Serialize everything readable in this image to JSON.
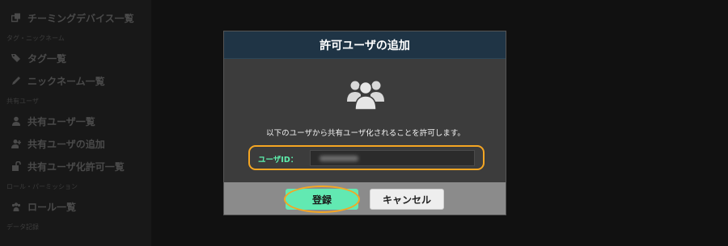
{
  "sidebar": {
    "items": [
      {
        "type": "item",
        "icon": "clone-icon",
        "label": "チーミングデバイス一覧"
      },
      {
        "type": "section",
        "label": "タグ・ニックネーム"
      },
      {
        "type": "item",
        "icon": "tags-icon",
        "label": "タグ一覧"
      },
      {
        "type": "item",
        "icon": "pencil-icon",
        "label": "ニックネーム一覧"
      },
      {
        "type": "section",
        "label": "共有ユーザ"
      },
      {
        "type": "item",
        "icon": "user-icon",
        "label": "共有ユーザ一覧"
      },
      {
        "type": "item",
        "icon": "user-plus-icon",
        "label": "共有ユーザの追加"
      },
      {
        "type": "item",
        "icon": "unlock-icon",
        "label": "共有ユーザ化許可一覧"
      },
      {
        "type": "section",
        "label": "ロール・パーミッション"
      },
      {
        "type": "item",
        "icon": "users-icon",
        "label": "ロール一覧"
      },
      {
        "type": "section",
        "label": "データ記録"
      }
    ]
  },
  "modal": {
    "title": "許可ユーザの追加",
    "icon": "users-icon",
    "message": "以下のユーザから共有ユーザ化されることを許可します。",
    "user_id_label": "ユーザID：",
    "user_id_value": "",
    "save_label": "登録",
    "cancel_label": "キャンセル"
  },
  "colors": {
    "header_bg": "#1f3445",
    "save_button": "#62e9b2",
    "highlight": "#f5a623",
    "label_accent": "#5ef0ad"
  }
}
